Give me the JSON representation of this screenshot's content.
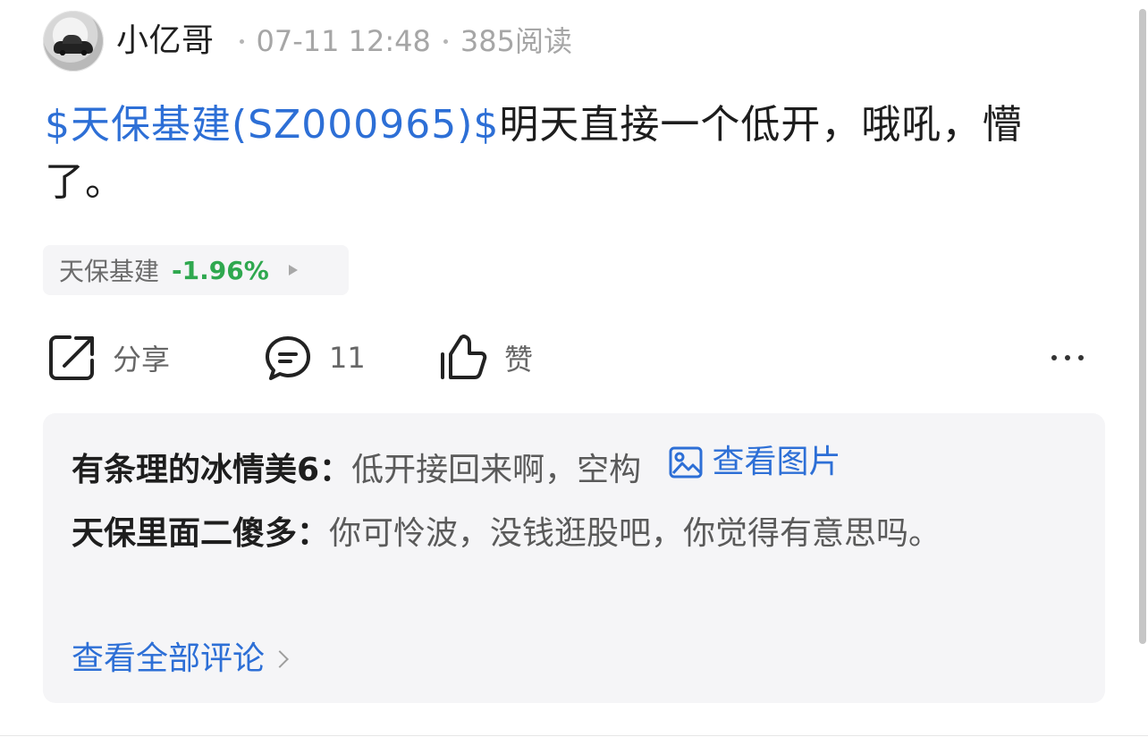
{
  "post": {
    "author": "小亿哥",
    "time": "07-11 12:48",
    "reads": "385阅读",
    "content_link": "$天保基建(SZ000965)$",
    "content_text": "明天直接一个低开，哦吼，懵了。"
  },
  "stock_chip": {
    "name": "天保基建",
    "change": "-1.96%"
  },
  "actions": {
    "share_label": "分享",
    "comment_count": "11",
    "like_label": "赞"
  },
  "comments": [
    {
      "user": "有条理的冰情美6：",
      "text": "低开接回来啊，空构",
      "link": "查看图片"
    },
    {
      "user": "天保里面二傻多：",
      "text": "你可怜波，没钱逛股吧，你觉得有意思吗。"
    }
  ],
  "view_all_comments": "查看全部评论",
  "colors": {
    "link_blue": "#2d6fd6",
    "down_green": "#2fa84f",
    "meta_gray": "#a6a6a6",
    "comment_bg": "#f5f5f7"
  },
  "icons": {
    "share": "share-icon",
    "comment": "comment-icon",
    "like": "thumbs-up-icon",
    "more": "more-icon",
    "image": "image-icon",
    "chevron": "chevron-right-icon"
  }
}
